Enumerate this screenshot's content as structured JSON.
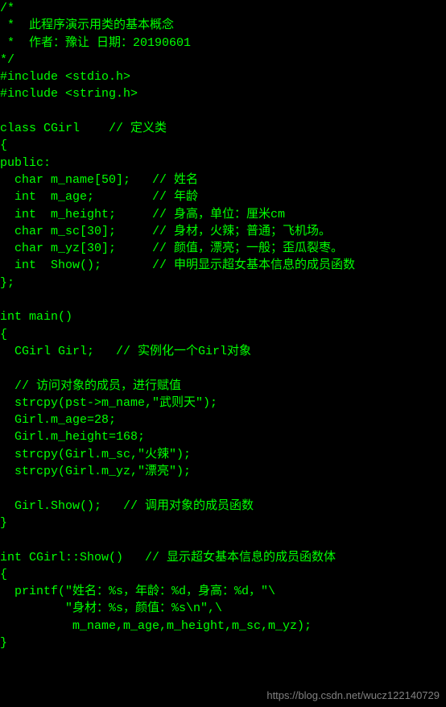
{
  "code": {
    "lines": [
      "/*",
      " *  此程序演示用类的基本概念",
      " *  作者：豫让 日期：20190601",
      "*/",
      "#include <stdio.h>",
      "#include <string.h>",
      "",
      "class CGirl    // 定义类",
      "{",
      "public:",
      "  char m_name[50];   // 姓名",
      "  int  m_age;        // 年龄",
      "  int  m_height;     // 身高，单位：厘米cm",
      "  char m_sc[30];     // 身材，火辣；普通；飞机场。",
      "  char m_yz[30];     // 颜值，漂亮；一般；歪瓜裂枣。",
      "  int  Show();       // 申明显示超女基本信息的成员函数",
      "};",
      "",
      "int main()",
      "{",
      "  CGirl Girl;   // 实例化一个Girl对象",
      "",
      "  // 访问对象的成员，进行赋值",
      "  strcpy(pst->m_name,\"武则天\");",
      "  Girl.m_age=28;",
      "  Girl.m_height=168;",
      "  strcpy(Girl.m_sc,\"火辣\");",
      "  strcpy(Girl.m_yz,\"漂亮\");",
      "",
      "  Girl.Show();   // 调用对象的成员函数",
      "}",
      "",
      "int CGirl::Show()   // 显示超女基本信息的成员函数体",
      "{",
      "  printf(\"姓名：%s，年龄：%d，身高：%d，\"\\",
      "         \"身材：%s，颜值：%s\\n\",\\",
      "          m_name,m_age,m_height,m_sc,m_yz);",
      "}"
    ]
  },
  "watermark": "https://blog.csdn.net/wucz122140729"
}
